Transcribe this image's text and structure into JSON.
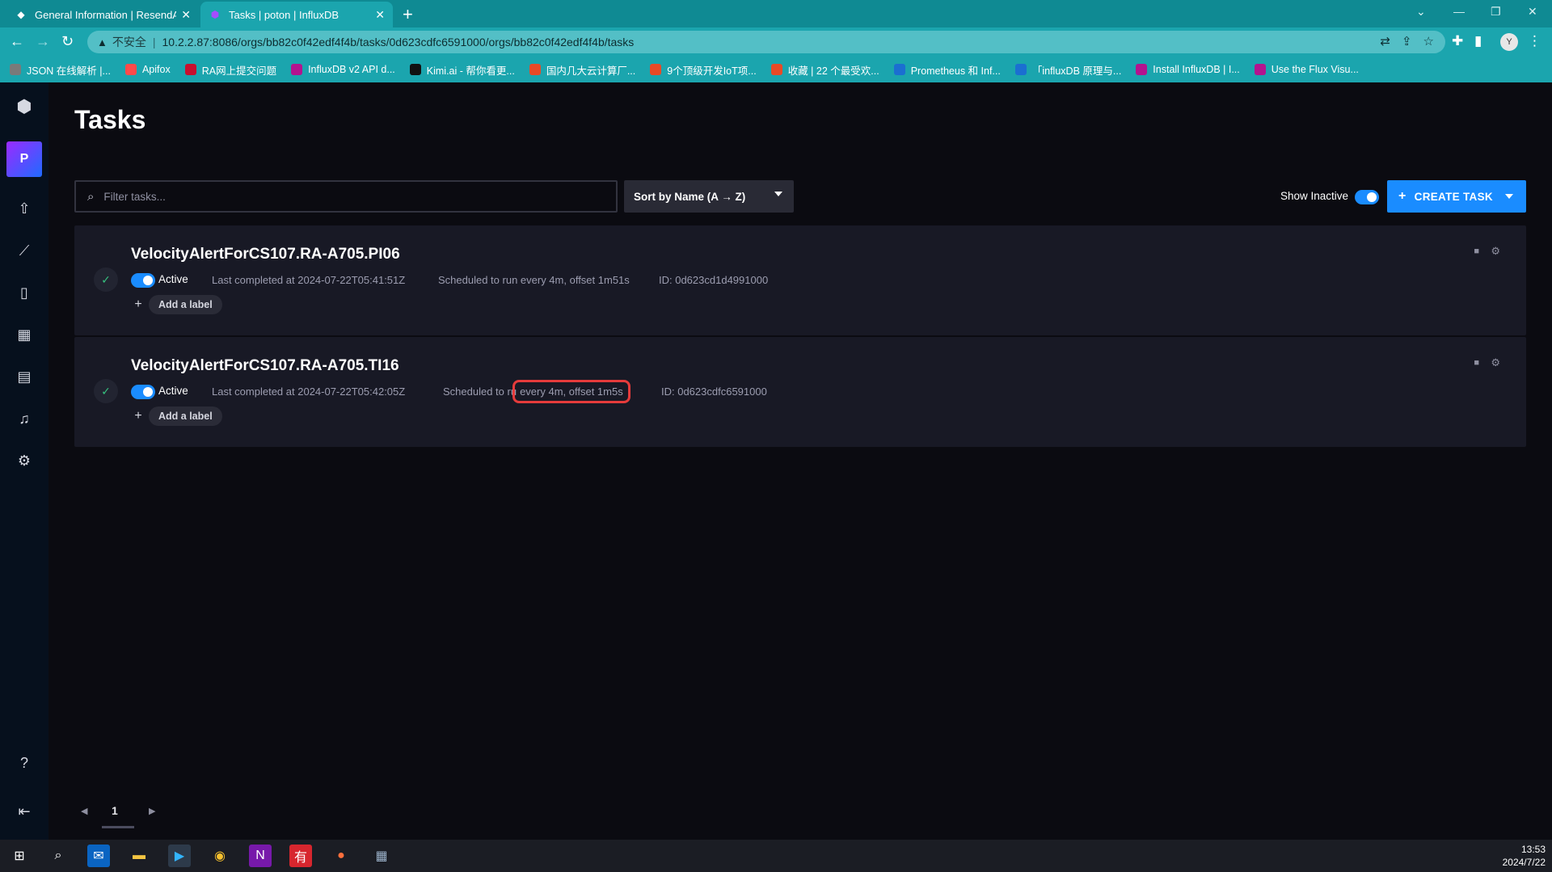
{
  "browser": {
    "tabs": [
      {
        "title": "General Information | ResendA",
        "active": false
      },
      {
        "title": "Tasks | poton | InfluxDB",
        "active": true
      }
    ],
    "address": {
      "security_label": "不安全",
      "url": "10.2.2.87:8086/orgs/bb82c0f42edf4f4b/tasks/0d623cdfc6591000/orgs/bb82c0f42edf4f4b/tasks"
    },
    "profile_initial": "Y",
    "bookmarks": [
      {
        "label": "JSON 在线解析 |...",
        "color": "#7a7a7a"
      },
      {
        "label": "Apifox",
        "color": "#ff4a4a"
      },
      {
        "label": "RA网上提交问题",
        "color": "#c8102e"
      },
      {
        "label": "InfluxDB v2 API d...",
        "color": "#b3148f"
      },
      {
        "label": "Kimi.ai - 帮你看更...",
        "color": "#111111"
      },
      {
        "label": "国内几大云计算厂...",
        "color": "#e84a27"
      },
      {
        "label": "9个顶级开发IoT项...",
        "color": "#e84a27"
      },
      {
        "label": "收藏 | 22 个最受欢...",
        "color": "#e84a27"
      },
      {
        "label": "Prometheus 和 Inf...",
        "color": "#1b6fd1"
      },
      {
        "label": "「influxDB 原理与...",
        "color": "#1b6fd1"
      },
      {
        "label": "Install InfluxDB | I...",
        "color": "#b3148f"
      },
      {
        "label": "Use the Flux Visu...",
        "color": "#b3148f"
      }
    ]
  },
  "sidebar": {
    "org_initial": "P",
    "icons": [
      "influx-logo-icon",
      "upload-icon",
      "graph-icon",
      "notebook-icon",
      "dashboard-icon",
      "calendar-icon",
      "bell-icon",
      "settings-icon",
      "help-icon",
      "collapse-icon"
    ]
  },
  "page": {
    "title": "Tasks",
    "filter_placeholder": "Filter tasks...",
    "sort_label": "Sort by Name (A → Z)",
    "show_inactive_label": "Show Inactive",
    "show_inactive_on": true,
    "create_label": "CREATE TASK"
  },
  "tasks": [
    {
      "name": "VelocityAlertForCS107.RA-A705.PI06",
      "status": "Active",
      "last_completed": "Last completed at 2024-07-22T05:41:51Z",
      "schedule_prefix": "Scheduled to run ",
      "schedule_value": "every 4m, offset 1m51s",
      "id": "ID: 0d623cd1d4991000",
      "add_label": "Add a label"
    },
    {
      "name": "VelocityAlertForCS107.RA-A705.TI16",
      "status": "Active",
      "last_completed": "Last completed at 2024-07-22T05:42:05Z",
      "schedule_prefix": "Scheduled to ru",
      "schedule_value": "every 4m, offset 1m5s",
      "id": "ID: 0d623cdfc6591000",
      "add_label": "Add a label"
    }
  ],
  "pagination": {
    "current": "1"
  },
  "taskbar": {
    "time": "13:53",
    "date": "2024/7/22"
  }
}
